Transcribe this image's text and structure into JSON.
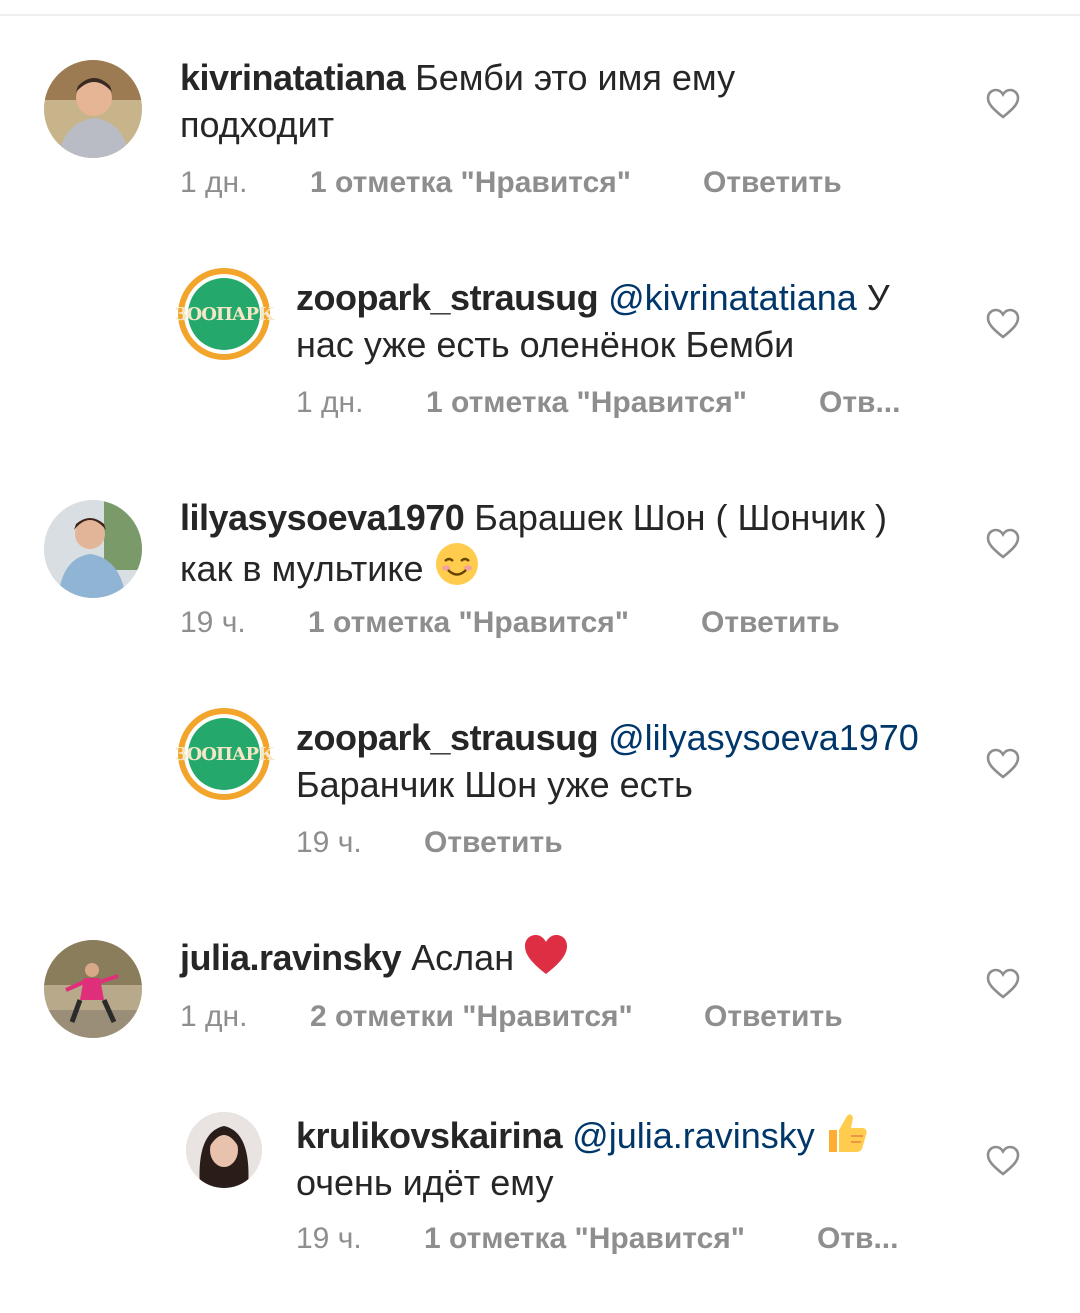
{
  "comments": [
    {
      "username": "kivrinatatiana",
      "text_line1": "Бемби это имя ему",
      "text_line2": "подходит",
      "time": "1 дн.",
      "likes": "1 отметка \"Нравится\"",
      "reply": "Ответить"
    },
    {
      "username": "zoopark_strausug",
      "mention": "@kivrinatatiana",
      "text_line1_tail": "У",
      "text_line2": "нас уже есть оленёнок Бемби",
      "time": "1 дн.",
      "likes": "1 отметка \"Нравится\"",
      "reply": "Отв..."
    },
    {
      "username": "lilyasysoeva1970",
      "text_line1": "Барашек Шон ( Шончик )",
      "text_line2": "как в мультике",
      "time": "19 ч.",
      "likes": "1 отметка \"Нравится\"",
      "reply": "Ответить"
    },
    {
      "username": "zoopark_strausug",
      "mention": "@lilyasysoeva1970",
      "text_line2": "Баранчик Шон уже есть",
      "time": "19 ч.",
      "reply": "Ответить"
    },
    {
      "username": "julia.ravinsky",
      "text_line1": "Аслан",
      "time": "1 дн.",
      "likes": "2 отметки \"Нравится\"",
      "reply": "Ответить"
    },
    {
      "username": "krulikovskairina",
      "mention": "@julia.ravinsky",
      "text_line2": "очень идёт ему",
      "time": "19 ч.",
      "likes": "1 отметка \"Нравится\"",
      "reply": "Отв..."
    }
  ],
  "zoo_logo_text": "ЗООПАРК",
  "colors": {
    "text": "#262626",
    "meta": "#8e8e8e",
    "mention": "#00376b",
    "zoo_green": "#25a86b",
    "zoo_ring": "#f2a52a"
  }
}
